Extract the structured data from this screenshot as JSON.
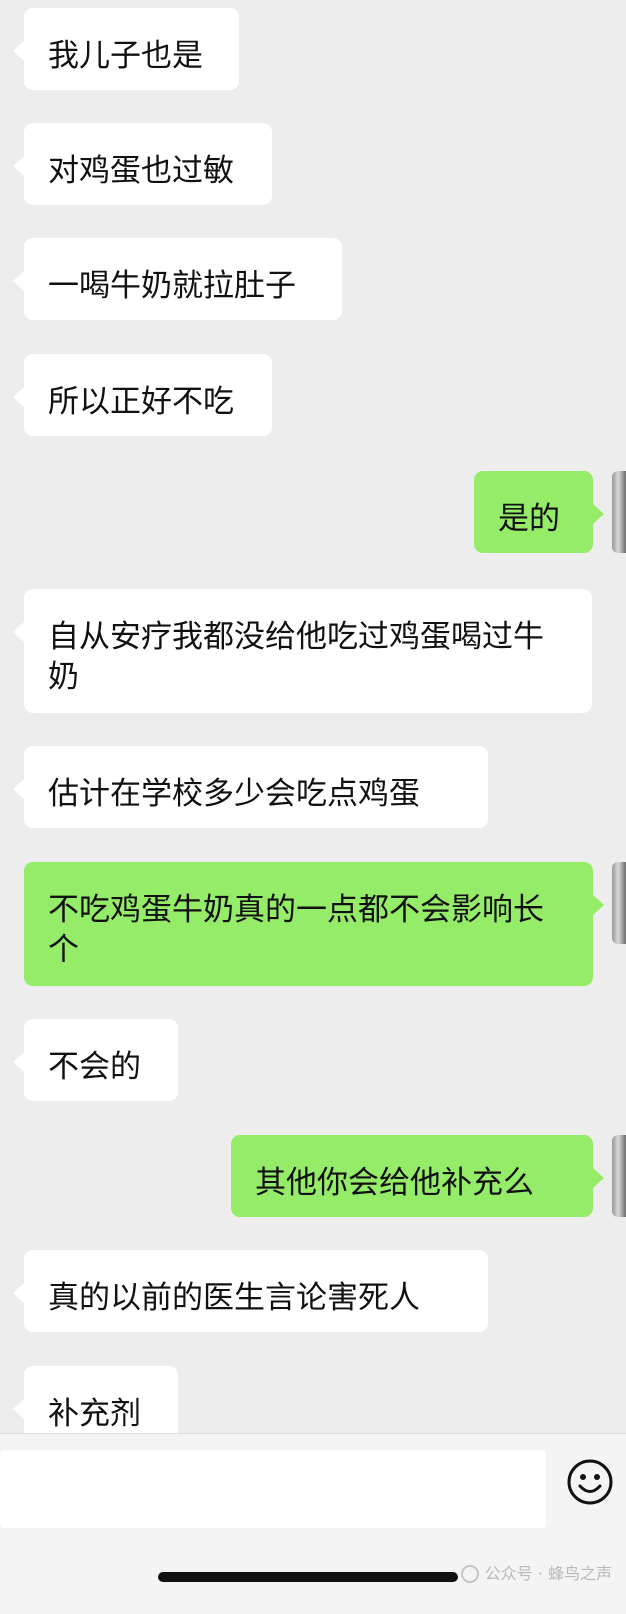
{
  "messages": [
    {
      "side": "in",
      "text": "我儿子也是"
    },
    {
      "side": "in",
      "text": "对鸡蛋也过敏"
    },
    {
      "side": "in",
      "text": "一喝牛奶就拉肚子"
    },
    {
      "side": "in",
      "text": "所以正好不吃"
    },
    {
      "side": "out",
      "text": "是的"
    },
    {
      "side": "in",
      "text": "自从安疗我都没给他吃过鸡蛋喝过牛奶"
    },
    {
      "side": "in",
      "text": "估计在学校多少会吃点鸡蛋"
    },
    {
      "side": "out",
      "text": "不吃鸡蛋牛奶真的一点都不会影响长个"
    },
    {
      "side": "in",
      "text": "不会的"
    },
    {
      "side": "out",
      "text": "其他你会给他补充么"
    },
    {
      "side": "in",
      "text": "真的以前的医生言论害死人"
    },
    {
      "side": "in",
      "text": "补充剂"
    }
  ],
  "input": {
    "value": ""
  },
  "icons": {
    "emoji": "smiley-icon",
    "watermark_logo": "wechat-public-account-icon"
  },
  "watermark": {
    "text": "公众号 · 蜂鸟之声"
  },
  "colors": {
    "background": "#ededed",
    "incoming_bubble": "#ffffff",
    "outgoing_bubble": "#95ec69"
  }
}
